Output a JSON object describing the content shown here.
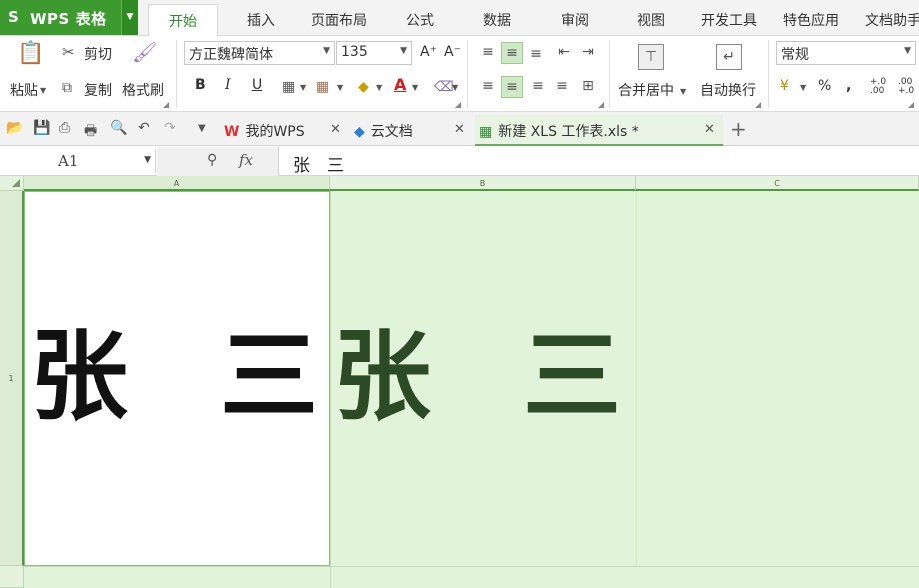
{
  "app": {
    "logo": "S",
    "name": "WPS 表格"
  },
  "menu_tabs": [
    "开始",
    "插入",
    "页面布局",
    "公式",
    "数据",
    "审阅",
    "视图",
    "开发工具",
    "特色应用",
    "文档助手"
  ],
  "ribbon": {
    "paste": "粘贴",
    "cut": "剪切",
    "copy": "复制",
    "format_painter": "格式刷",
    "font_name": "方正魏碑简体",
    "font_size": "135",
    "grow_font": "A⁺",
    "shrink_font": "A⁻",
    "bold": "B",
    "italic": "I",
    "underline": "U",
    "merge_center": "合并居中",
    "wrap_text": "自动换行",
    "number_format": "常规",
    "percent": "%",
    "comma": ",",
    "inc_decimal": "+.0 .00",
    "dec_decimal": ".00 +.0"
  },
  "doc_tabs": [
    {
      "label": "我的WPS",
      "active": false
    },
    {
      "label": "云文档",
      "active": false
    },
    {
      "label": "新建 XLS 工作表.xls *",
      "active": true
    }
  ],
  "formula_bar": {
    "cell_ref": "A1",
    "fx": "fx",
    "content": "张　三"
  },
  "columns": [
    "A",
    "B",
    "C"
  ],
  "rows": [
    "1"
  ],
  "cells": {
    "A1": [
      "张",
      "三"
    ],
    "B1": [
      "张",
      "三"
    ]
  },
  "colors": {
    "accent": "#3d9a2f",
    "grid_bg": "#e1f3d8",
    "cell_text": "#111111",
    "overflow_text": "#2d4a26"
  }
}
